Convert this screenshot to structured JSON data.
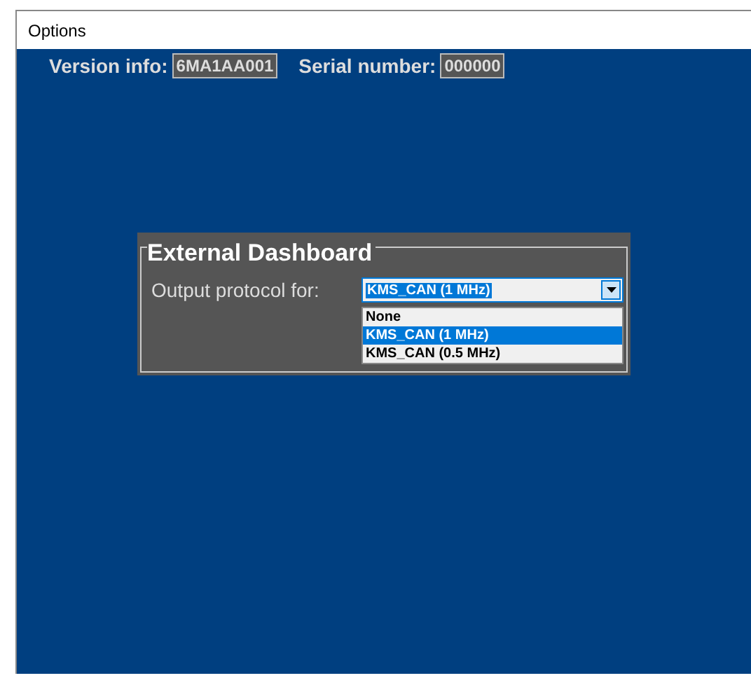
{
  "window": {
    "title": "Options"
  },
  "info": [
    {
      "label": "Version info:",
      "value": "6MA1AA001"
    },
    {
      "label": "Serial number:",
      "value": "000000"
    }
  ],
  "group": {
    "title": "External Dashboard",
    "label": "Output protocol for:",
    "combo": {
      "value": "KMS_CAN (1 MHz)",
      "expanded": true,
      "options": [
        {
          "label": "None",
          "selected": false
        },
        {
          "label": "KMS_CAN (1 MHz)",
          "selected": true
        },
        {
          "label": "KMS_CAN (0.5 MHz)",
          "selected": false
        }
      ]
    }
  }
}
